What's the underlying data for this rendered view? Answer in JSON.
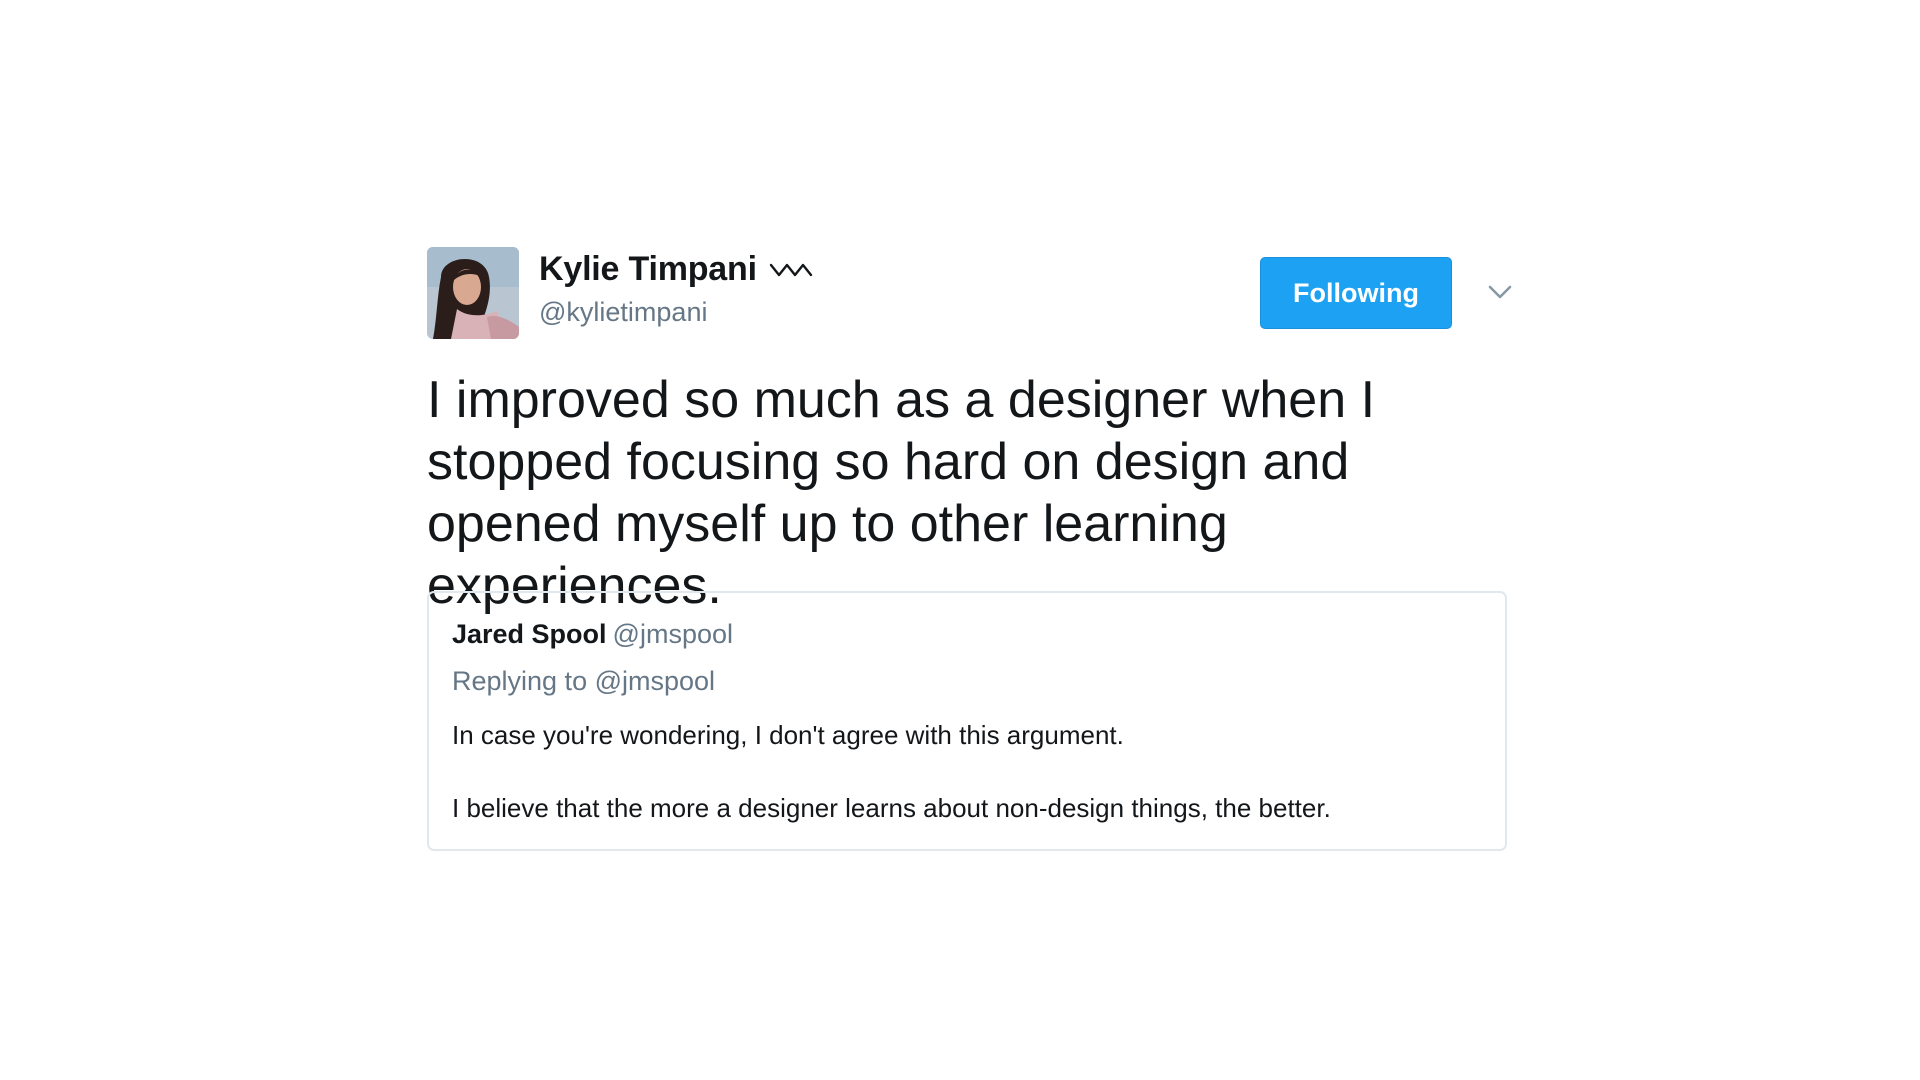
{
  "author": {
    "display_name": "Kylie Timpani",
    "handle": "@kylietimpani",
    "avatar_icon": "avatar-photo",
    "badge_icon": "squiggle-icon"
  },
  "follow_button": {
    "label": "Following",
    "color": "#1da1f2"
  },
  "menu": {
    "icon": "chevron-down-icon"
  },
  "tweet": {
    "text_lines": [
      "I improved so much as a designer when I",
      "stopped focusing so hard on design and",
      "opened myself up to other learning experiences."
    ]
  },
  "quoted_tweet": {
    "display_name": "Jared Spool",
    "handle": "@jmspool",
    "replying_to": "Replying to @jmspool",
    "lines": [
      "In case you're wondering, I don't agree with this argument.",
      "I believe that the more a designer learns about non-design things, the better."
    ]
  }
}
